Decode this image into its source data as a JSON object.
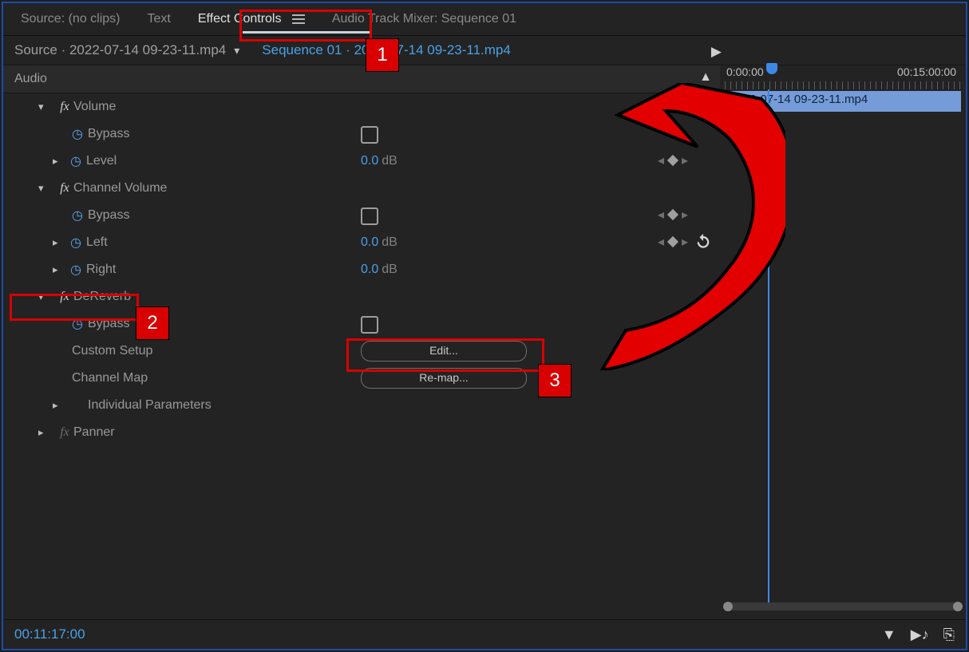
{
  "tabs": {
    "source": "Source: (no clips)",
    "text": "Text",
    "effect_controls": "Effect Controls",
    "audio_mixer": "Audio Track Mixer: Sequence 01"
  },
  "source_line": {
    "prefix": "Source · 2022-07-14 09-23-11.mp4",
    "link": "Sequence 01 · 2022-07-14 09-23-11.mp4"
  },
  "timeline": {
    "start": "0:00:00",
    "end": "00:15:00:00",
    "clip_name": "2022-07-14 09-23-11.mp4"
  },
  "section_header": "Audio",
  "effects": {
    "volume": {
      "name": "Volume",
      "bypass": "Bypass",
      "level_label": "Level",
      "level_value": "0.0",
      "level_unit": "dB"
    },
    "channel_volume": {
      "name": "Channel Volume",
      "bypass": "Bypass",
      "left_label": "Left",
      "left_value": "0.0",
      "left_unit": "dB",
      "right_label": "Right",
      "right_value": "0.0",
      "right_unit": "dB"
    },
    "dereverb": {
      "name": "DeReverb",
      "bypass": "Bypass",
      "custom_setup": "Custom Setup",
      "edit_btn": "Edit...",
      "channel_map": "Channel Map",
      "remap_btn": "Re-map...",
      "individual": "Individual Parameters"
    },
    "panner": {
      "name": "Panner"
    }
  },
  "footer": {
    "timecode": "00:11:17:00"
  },
  "callouts": {
    "c1": "1",
    "c2": "2",
    "c3": "3"
  }
}
